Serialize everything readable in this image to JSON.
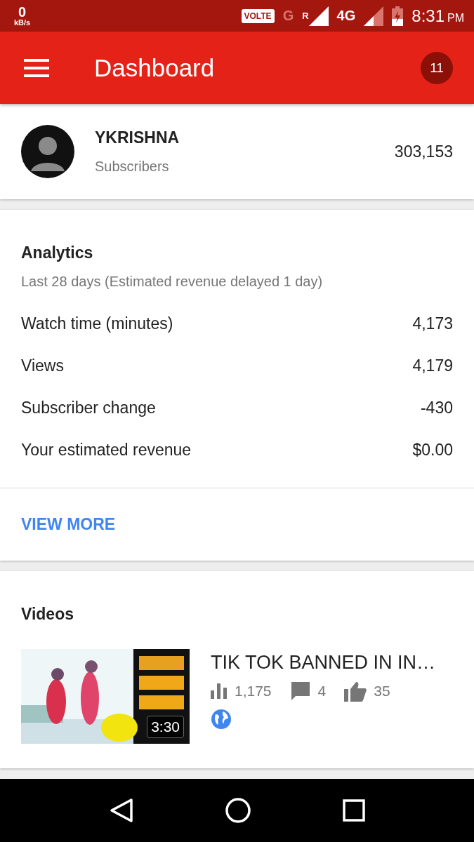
{
  "status_bar": {
    "speed_value": "0",
    "speed_unit": "kB/s",
    "volte": "VOLTE",
    "network_g": "G",
    "roaming": "R",
    "network_4g": "4G",
    "time": "8:31",
    "ampm": "PM"
  },
  "app_bar": {
    "title": "Dashboard",
    "notification_count": "11"
  },
  "channel": {
    "name": "YKRISHNA",
    "subscribers_label": "Subscribers",
    "subscribers": "303,153"
  },
  "analytics": {
    "title": "Analytics",
    "subtitle": "Last 28 days (Estimated revenue delayed 1 day)",
    "rows": [
      {
        "label": "Watch time (minutes)",
        "value": "4,173"
      },
      {
        "label": "Views",
        "value": "4,179"
      },
      {
        "label": "Subscriber change",
        "value": "-430"
      },
      {
        "label": "Your estimated revenue",
        "value": "$0.00"
      }
    ],
    "action": "VIEW MORE"
  },
  "videos": {
    "title": "Videos",
    "items": [
      {
        "duration": "3:30",
        "title": "TIK TOK BANNED IN IN…",
        "views": "1,175",
        "comments": "4",
        "likes": "35",
        "public": true
      }
    ]
  }
}
